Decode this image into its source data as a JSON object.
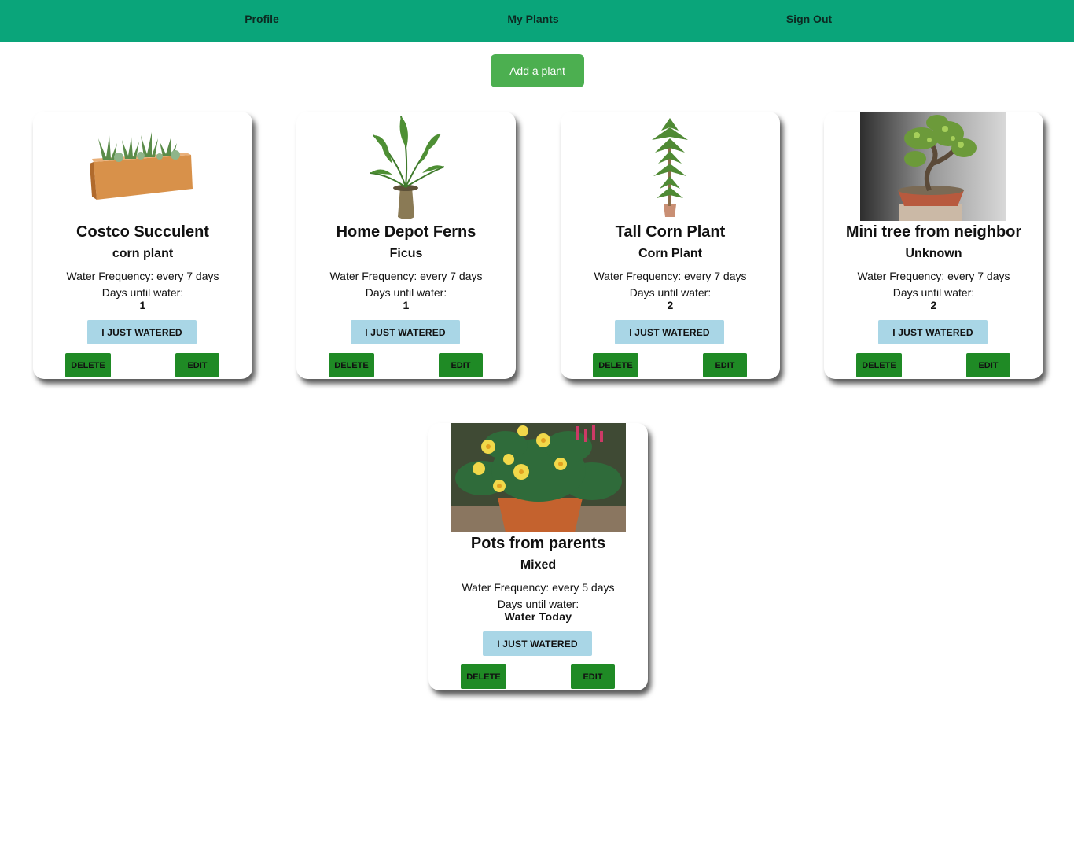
{
  "nav": {
    "profile": "Profile",
    "my_plants": "My Plants",
    "sign_out": "Sign Out"
  },
  "add_plant_label": "Add a plant",
  "labels": {
    "water_frequency_prefix": "Water Frequency: every",
    "days_until": "Days until water:",
    "watered": "I JUST WATERED",
    "delete": "DELETE",
    "edit": "EDIT"
  },
  "plants": [
    {
      "name": "Costco Succulent",
      "species": "corn plant",
      "frequency": "Water Frequency: every 7 days",
      "days_until": "1",
      "image": "succulent-planter-photo"
    },
    {
      "name": "Home Depot Ferns",
      "species": "Ficus",
      "frequency": "Water Frequency: every 7 days",
      "days_until": "1",
      "image": "potted-palm-photo"
    },
    {
      "name": "Tall Corn Plant",
      "species": "Corn Plant",
      "frequency": "Water Frequency: every 7 days",
      "days_until": "2",
      "image": "corn-plant-photo"
    },
    {
      "name": "Mini tree from neighbor",
      "species": "Unknown",
      "frequency": "Water Frequency: every 7 days",
      "days_until": "2",
      "image": "bonsai-tree-photo"
    },
    {
      "name": "Pots from parents",
      "species": "Mixed",
      "frequency": "Water Frequency: every 5 days",
      "days_until": "Water Today",
      "image": "flower-pot-photo"
    }
  ],
  "colors": {
    "navbar": "#0aa57a",
    "add_button": "#4caf50",
    "watered_button": "#a9d6e6",
    "action_button": "#1f8a25"
  }
}
